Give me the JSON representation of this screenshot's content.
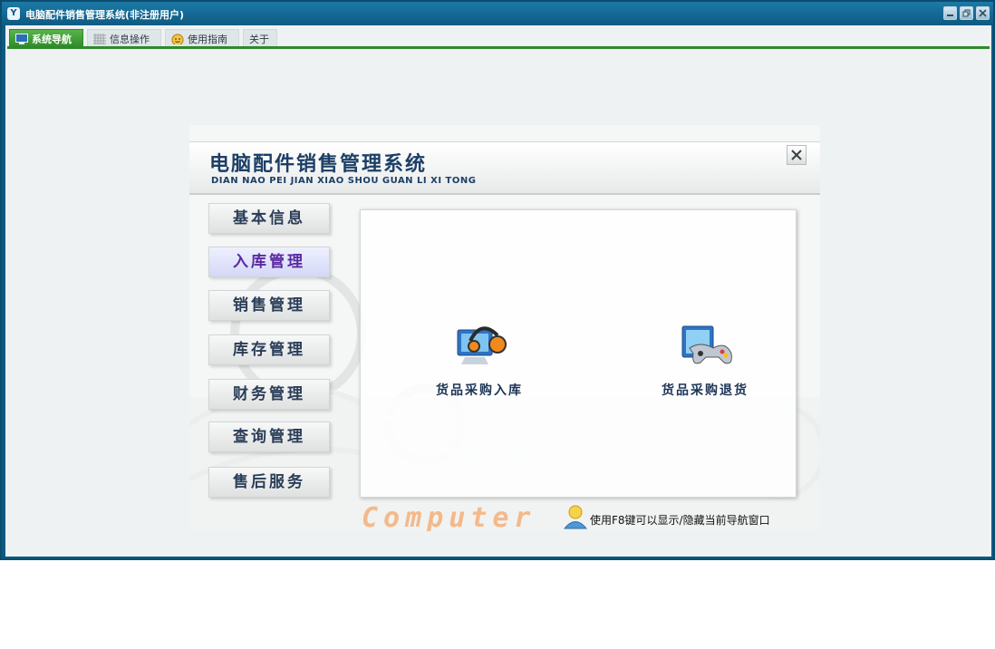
{
  "window": {
    "title": "电脑配件销售管理系统(非注册用户)",
    "app_icon_glyph": "Y",
    "buttons": [
      "minimize-icon",
      "restore-icon",
      "close-icon"
    ]
  },
  "tabs": [
    {
      "label": "系统导航",
      "active": true,
      "icon": "monitor-icon"
    },
    {
      "label": "信息操作",
      "active": false,
      "icon": "grid-icon"
    },
    {
      "label": "使用指南",
      "active": false,
      "icon": "smiley-icon"
    },
    {
      "label": "关于",
      "active": false,
      "icon": ""
    }
  ],
  "nav_panel": {
    "title": "电脑配件销售管理系统",
    "subtitle": "DIAN NAO PEI JIAN XIAO SHOU GUAN LI XI TONG",
    "menu": [
      {
        "label": "基本信息",
        "active": false
      },
      {
        "label": "入库管理",
        "active": true
      },
      {
        "label": "销售管理",
        "active": false
      },
      {
        "label": "库存管理",
        "active": false
      },
      {
        "label": "财务管理",
        "active": false
      },
      {
        "label": "查询管理",
        "active": false
      },
      {
        "label": "售后服务",
        "active": false
      }
    ],
    "items": [
      {
        "label": "货品采购入库",
        "icon": "headset-computer-icon"
      },
      {
        "label": "货品采购退货",
        "icon": "gamepad-computer-icon"
      }
    ],
    "brand_text": "Computer",
    "hint": "使用F8键可以显示/隐藏当前导航窗口"
  },
  "colors": {
    "titlebar": "#0c5a82",
    "tab_active": "#2f8a2a",
    "menu_text": "#2a3d57",
    "menu_active_text": "#5a2aa0"
  }
}
